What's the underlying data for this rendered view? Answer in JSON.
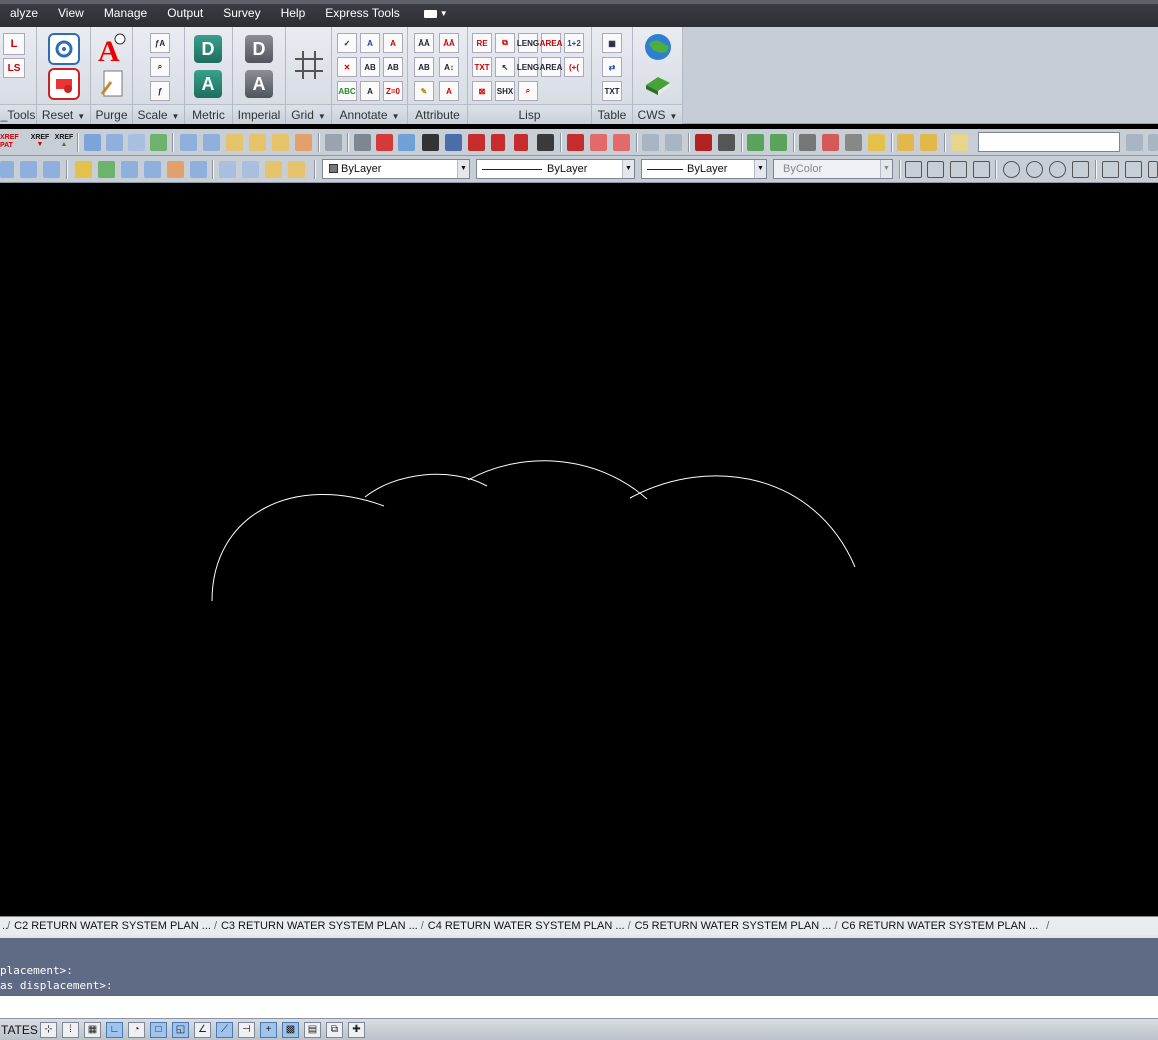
{
  "menubar": {
    "items": [
      "alyze",
      "View",
      "Manage",
      "Output",
      "Survey",
      "Help",
      "Express Tools"
    ]
  },
  "ribbon": {
    "panels": [
      {
        "label": "_Tools",
        "dropdown": false,
        "buttons": [
          "L",
          "LS"
        ]
      },
      {
        "label": "Reset",
        "dropdown": true
      },
      {
        "label": "Purge",
        "dropdown": false
      },
      {
        "label": "Scale",
        "dropdown": true
      },
      {
        "label": "Metric",
        "dropdown": false,
        "glyph_top": "D",
        "glyph_bottom": "A"
      },
      {
        "label": "Imperial",
        "dropdown": false,
        "glyph_top": "D",
        "glyph_bottom": "A"
      },
      {
        "label": "Grid",
        "dropdown": true
      },
      {
        "label": "Annotate",
        "dropdown": true
      },
      {
        "label": "Attribute",
        "dropdown": false
      },
      {
        "label": "Lisp",
        "dropdown": false,
        "buttons": [
          "RE",
          "LENG",
          "AREA",
          "1+2",
          "TXT",
          "LENG",
          "AREA",
          "(+(",
          "SHX"
        ]
      },
      {
        "label": "Table",
        "dropdown": false,
        "buttons": [
          "TXT"
        ]
      },
      {
        "label": "CWS",
        "dropdown": true
      }
    ]
  },
  "toolbar1": {
    "xref_labels": [
      "XREF",
      "PAT",
      "XREF",
      "XREF"
    ]
  },
  "properties": {
    "layer_color": "ByLayer",
    "linetype": "ByLayer",
    "lineweight": "ByLayer",
    "plotstyle": "ByColor"
  },
  "layout_tabs": {
    "lead": "..",
    "tabs": [
      "C2 RETURN WATER SYSTEM PLAN ...",
      "C3 RETURN WATER SYSTEM PLAN ...",
      "C4 RETURN WATER SYSTEM PLAN ...",
      "C5 RETURN WATER SYSTEM PLAN ...",
      "C6 RETURN WATER SYSTEM PLAN ..."
    ],
    "trail": "/"
  },
  "command_line": {
    "lines": [
      "placement>:",
      "as displacement>:"
    ]
  },
  "statusbar": {
    "coords": "TATES"
  },
  "colors": {
    "canvas": "#000000",
    "geometry": "#ffffff",
    "command_bg": "#5f6a84"
  }
}
